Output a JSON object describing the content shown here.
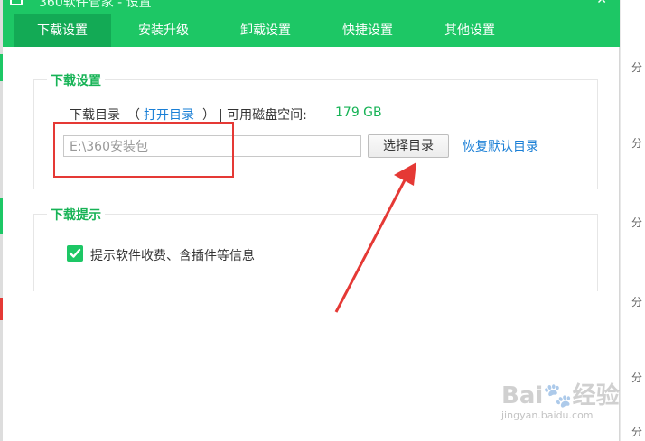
{
  "window": {
    "title": "360软件管家 - 设置",
    "close_glyph": "✕"
  },
  "tabs": [
    {
      "label": "下载设置",
      "active": true
    },
    {
      "label": "安装升级",
      "active": false
    },
    {
      "label": "卸载设置",
      "active": false
    },
    {
      "label": "快捷设置",
      "active": false
    },
    {
      "label": "其他设置",
      "active": false
    }
  ],
  "download_settings": {
    "group_title": "下载设置",
    "dir_label": "下载目录",
    "open_paren": "（",
    "open_dir_link": "打开目录",
    "close_paren": "）",
    "space_label": "| 可用磁盘空间:",
    "free_space": "179 GB",
    "path_value": "E:\\360安装包",
    "select_button": "选择目录",
    "restore_link": "恢复默认目录"
  },
  "download_tips": {
    "group_title": "下载提示",
    "checkbox_label": "提示软件收费、含插件等信息",
    "checked": true
  },
  "background": {
    "right_labels": [
      "分",
      "分",
      "分",
      "分",
      "分",
      "分"
    ]
  },
  "watermark": {
    "main": "Bai🐾经验",
    "sub": "jingyan.baidu.com"
  },
  "colors": {
    "brand": "#1dc765",
    "tab_active": "#13aa55",
    "link": "#1a7fd6",
    "annotation": "#e53935"
  }
}
